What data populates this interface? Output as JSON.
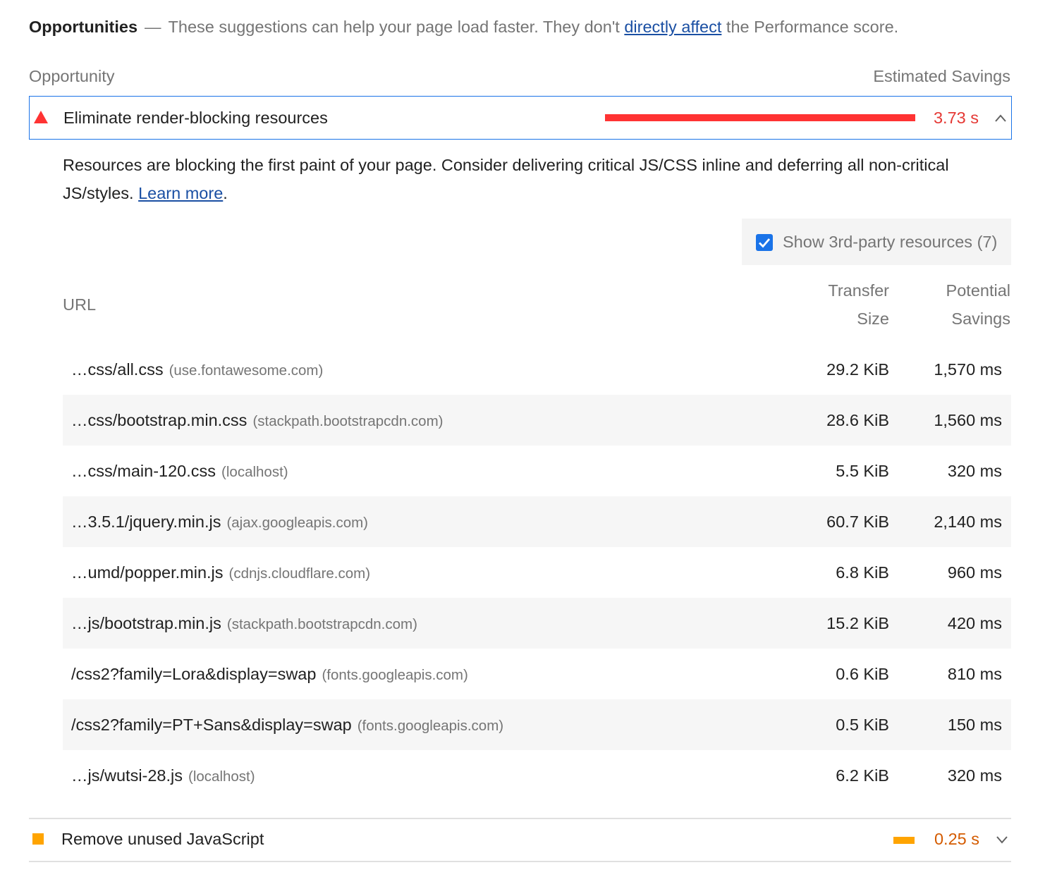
{
  "header": {
    "title": "Opportunities",
    "dash": "—",
    "text_before_link": "These suggestions can help your page load faster. They don't ",
    "link": "directly affect",
    "text_after_link": " the Performance score."
  },
  "columns": {
    "opportunity": "Opportunity",
    "estimated_savings": "Estimated Savings"
  },
  "audits": [
    {
      "title": "Eliminate render-blocking resources",
      "value": "3.73 s",
      "bar_fraction": 1.0,
      "status": "fail",
      "color": "#ff3333",
      "value_color": "#e53935",
      "expanded": true,
      "icon": "red-triangle-icon"
    },
    {
      "title": "Remove unused JavaScript",
      "value": "0.25 s",
      "bar_fraction": 0.068,
      "status": "average",
      "color": "#ffa400",
      "value_color": "#d45b00",
      "expanded": false,
      "icon": "orange-square-icon"
    }
  ],
  "details": {
    "description": "Resources are blocking the first paint of your page. Consider delivering critical JS/CSS inline and deferring all non-critical JS/styles. ",
    "learn_more": "Learn more",
    "period": ".",
    "third_party": {
      "label": "Show 3rd-party resources (7)",
      "checked": true
    },
    "table": {
      "headers": {
        "url": "URL",
        "transfer_size_1": "Transfer",
        "transfer_size_2": "Size",
        "potential_savings_1": "Potential",
        "potential_savings_2": "Savings"
      },
      "rows": [
        {
          "url": "…css/all.css",
          "host": "(use.fontawesome.com)",
          "size": "29.2 KiB",
          "savings": "1,570 ms"
        },
        {
          "url": "…css/bootstrap.min.css",
          "host": "(stackpath.bootstrapcdn.com)",
          "size": "28.6 KiB",
          "savings": "1,560 ms"
        },
        {
          "url": "…css/main-120.css",
          "host": "(localhost)",
          "size": "5.5 KiB",
          "savings": "320 ms"
        },
        {
          "url": "…3.5.1/jquery.min.js",
          "host": "(ajax.googleapis.com)",
          "size": "60.7 KiB",
          "savings": "2,140 ms"
        },
        {
          "url": "…umd/popper.min.js",
          "host": "(cdnjs.cloudflare.com)",
          "size": "6.8 KiB",
          "savings": "960 ms"
        },
        {
          "url": "…js/bootstrap.min.js",
          "host": "(stackpath.bootstrapcdn.com)",
          "size": "15.2 KiB",
          "savings": "420 ms"
        },
        {
          "url": "/css2?family=Lora&display=swap",
          "host": "(fonts.googleapis.com)",
          "size": "0.6 KiB",
          "savings": "810 ms"
        },
        {
          "url": "/css2?family=PT+Sans&display=swap",
          "host": "(fonts.googleapis.com)",
          "size": "0.5 KiB",
          "savings": "150 ms"
        },
        {
          "url": "…js/wutsi-28.js",
          "host": "(localhost)",
          "size": "6.2 KiB",
          "savings": "320 ms"
        }
      ]
    }
  }
}
